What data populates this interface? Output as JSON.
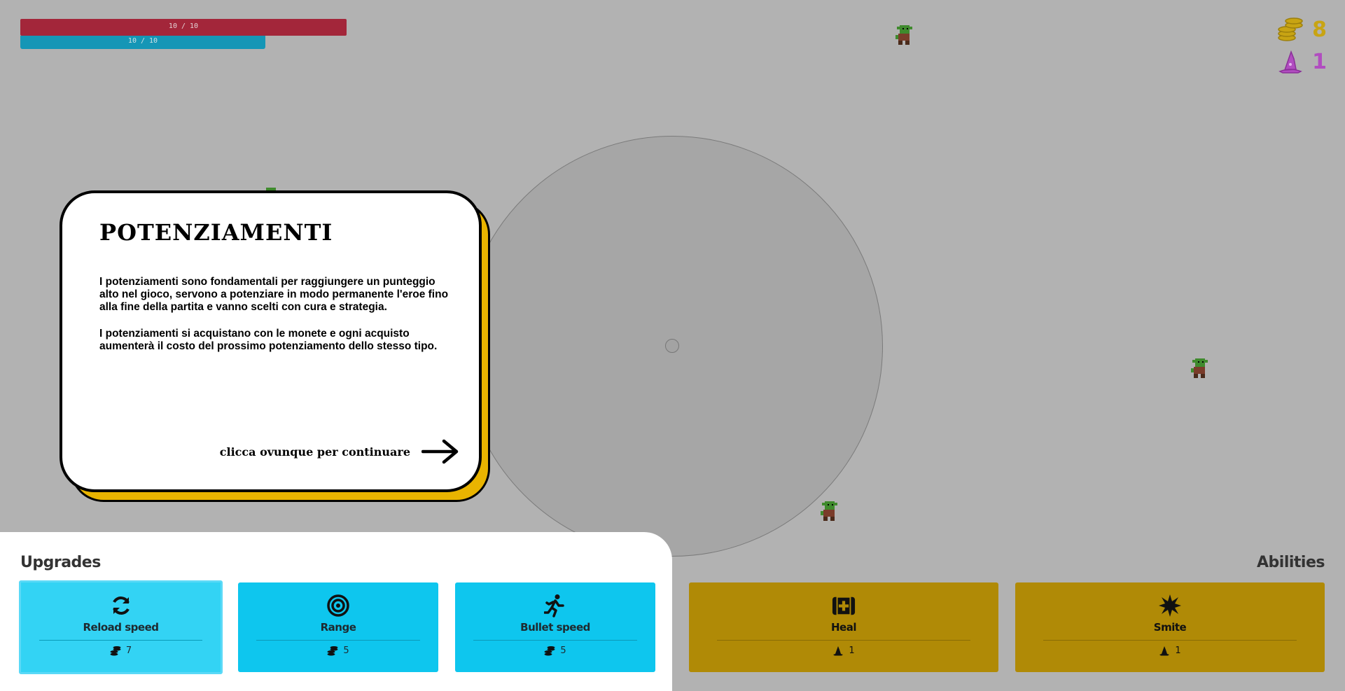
{
  "hud": {
    "hp_text": "10 / 10",
    "mana_text": "10 / 10",
    "coins": "8",
    "hats": "1",
    "colors": {
      "hp": "#a3263a",
      "mana": "#1596b6",
      "coins": "#c8a413",
      "hats": "#b14dc0"
    }
  },
  "tutorial": {
    "title": "POTENZIAMENTI",
    "paragraph1": "I potenziamenti sono fondamentali per raggiungere un punteggio alto nel gioco, servono a potenziare in modo permanente l'eroe fino alla fine della partita e vanno scelti con cura e strategia.",
    "paragraph2": "I potenziamenti si acquistano con le monete e ogni acquisto aumenterà il costo del prossimo potenziamento dello stesso tipo.",
    "continue": "clicca ovunque per continuare"
  },
  "upgrades": {
    "title": "Upgrades",
    "items": [
      {
        "name": "Reload speed",
        "cost": "7",
        "icon": "reload-icon",
        "selected": true
      },
      {
        "name": "Range",
        "cost": "5",
        "icon": "target-icon"
      },
      {
        "name": "Bullet speed",
        "cost": "5",
        "icon": "running-icon"
      }
    ]
  },
  "abilities": {
    "title": "Abilities",
    "items": [
      {
        "name": "Heal",
        "cost": "1",
        "icon": "medkit-icon"
      },
      {
        "name": "Smite",
        "cost": "1",
        "icon": "burst-icon"
      }
    ]
  }
}
